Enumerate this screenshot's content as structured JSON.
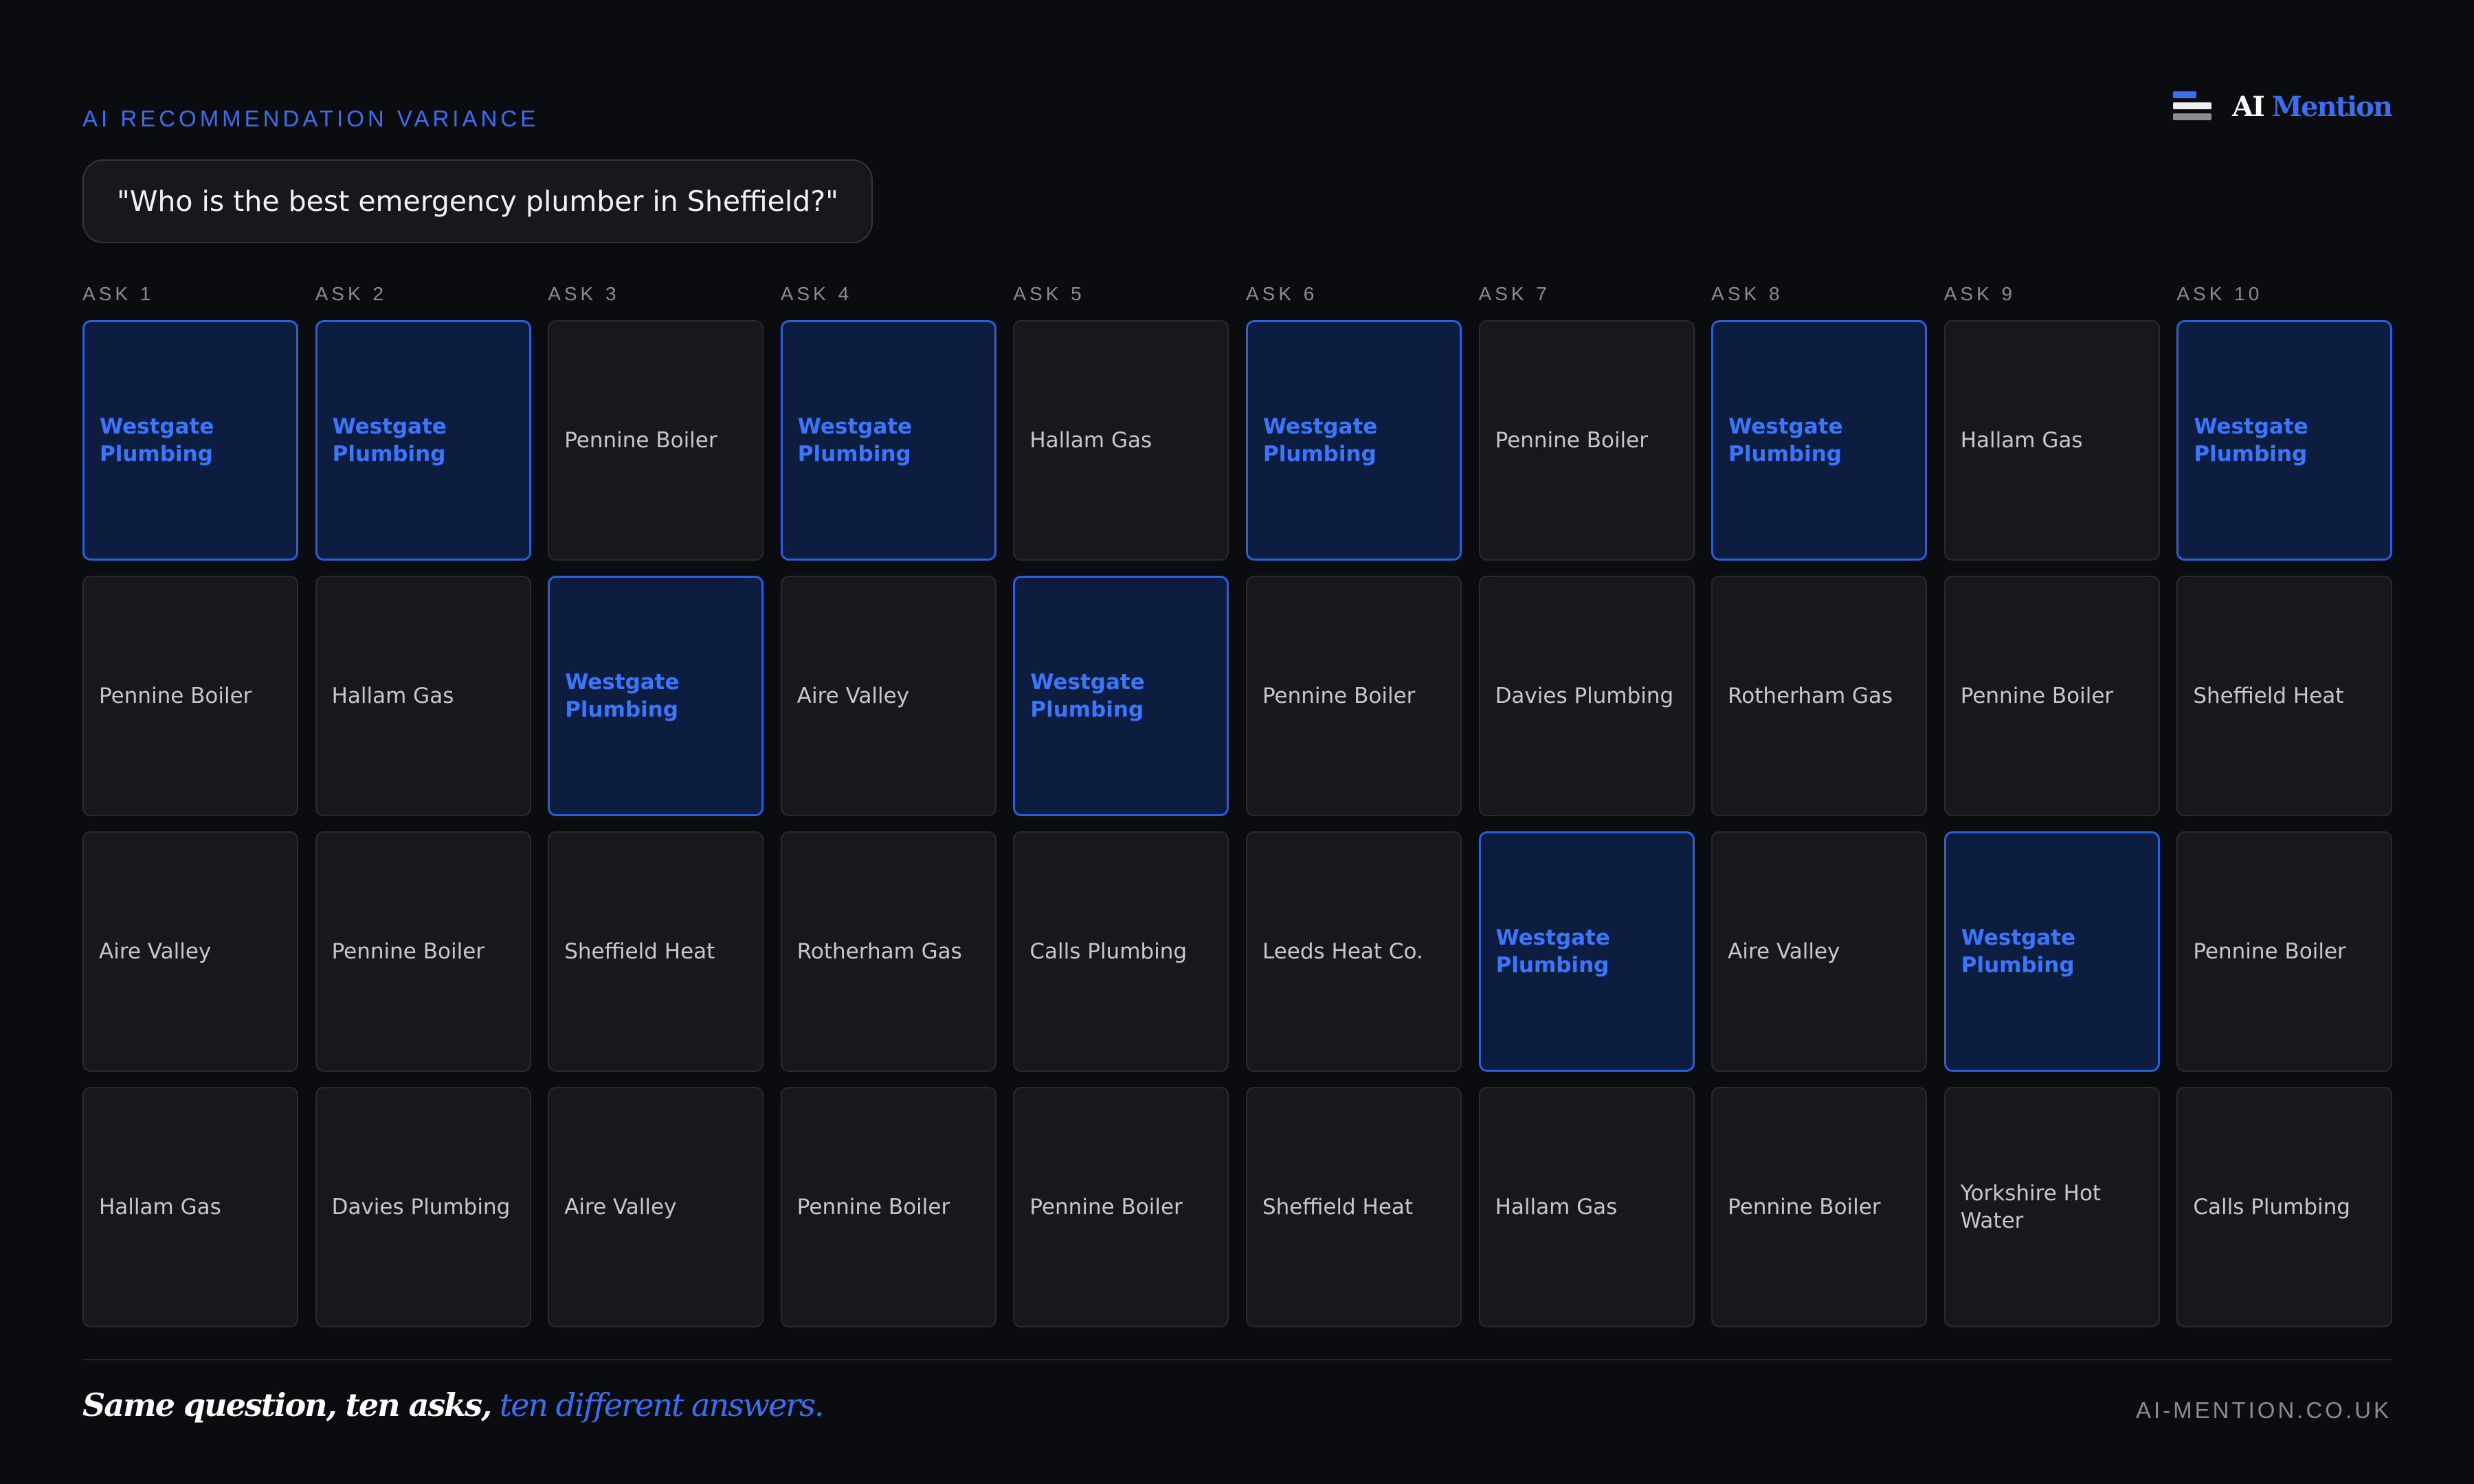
{
  "header": {
    "eyebrow": "AI RECOMMENDATION VARIANCE",
    "question": "\"Who is the best emergency plumber in Sheffield?\"",
    "brand": {
      "ai": "AI",
      "mention": "Mention"
    }
  },
  "asks": [
    "ASK 1",
    "ASK 2",
    "ASK 3",
    "ASK 4",
    "ASK 5",
    "ASK 6",
    "ASK 7",
    "ASK 8",
    "ASK 9",
    "ASK 10"
  ],
  "rows": [
    [
      {
        "name": "Westgate Plumbing",
        "highlight": true
      },
      {
        "name": "Westgate Plumbing",
        "highlight": true
      },
      {
        "name": "Pennine Boiler",
        "highlight": false
      },
      {
        "name": "Westgate Plumbing",
        "highlight": true
      },
      {
        "name": "Hallam Gas",
        "highlight": false
      },
      {
        "name": "Westgate Plumbing",
        "highlight": true
      },
      {
        "name": "Pennine Boiler",
        "highlight": false
      },
      {
        "name": "Westgate Plumbing",
        "highlight": true
      },
      {
        "name": "Hallam Gas",
        "highlight": false
      },
      {
        "name": "Westgate Plumbing",
        "highlight": true
      }
    ],
    [
      {
        "name": "Pennine Boiler",
        "highlight": false
      },
      {
        "name": "Hallam Gas",
        "highlight": false
      },
      {
        "name": "Westgate Plumbing",
        "highlight": true
      },
      {
        "name": "Aire Valley",
        "highlight": false
      },
      {
        "name": "Westgate Plumbing",
        "highlight": true
      },
      {
        "name": "Pennine Boiler",
        "highlight": false
      },
      {
        "name": "Davies Plumbing",
        "highlight": false
      },
      {
        "name": "Rotherham Gas",
        "highlight": false
      },
      {
        "name": "Pennine Boiler",
        "highlight": false
      },
      {
        "name": "Sheffield Heat",
        "highlight": false
      }
    ],
    [
      {
        "name": "Aire Valley",
        "highlight": false
      },
      {
        "name": "Pennine Boiler",
        "highlight": false
      },
      {
        "name": "Sheffield Heat",
        "highlight": false
      },
      {
        "name": "Rotherham Gas",
        "highlight": false
      },
      {
        "name": "Calls Plumbing",
        "highlight": false
      },
      {
        "name": "Leeds Heat Co.",
        "highlight": false
      },
      {
        "name": "Westgate Plumbing",
        "highlight": true
      },
      {
        "name": "Aire Valley",
        "highlight": false
      },
      {
        "name": "Westgate Plumbing",
        "highlight": true
      },
      {
        "name": "Pennine Boiler",
        "highlight": false
      }
    ],
    [
      {
        "name": "Hallam Gas",
        "highlight": false
      },
      {
        "name": "Davies Plumbing",
        "highlight": false
      },
      {
        "name": "Aire Valley",
        "highlight": false
      },
      {
        "name": "Pennine Boiler",
        "highlight": false
      },
      {
        "name": "Pennine Boiler",
        "highlight": false
      },
      {
        "name": "Sheffield Heat",
        "highlight": false
      },
      {
        "name": "Hallam Gas",
        "highlight": false
      },
      {
        "name": "Pennine Boiler",
        "highlight": false
      },
      {
        "name": "Yorkshire Hot Water",
        "highlight": false
      },
      {
        "name": "Calls Plumbing",
        "highlight": false
      }
    ]
  ],
  "footer": {
    "tagline_lead": "Same question, ten asks,",
    "tagline_accent": "ten different answers.",
    "site": "AI-MENTION.CO.UK"
  },
  "colors": {
    "background": "#0b0c0f",
    "accent": "#3a6ff2",
    "highlight_fill": "#0d1d3f",
    "cell_fill": "#17181b"
  }
}
